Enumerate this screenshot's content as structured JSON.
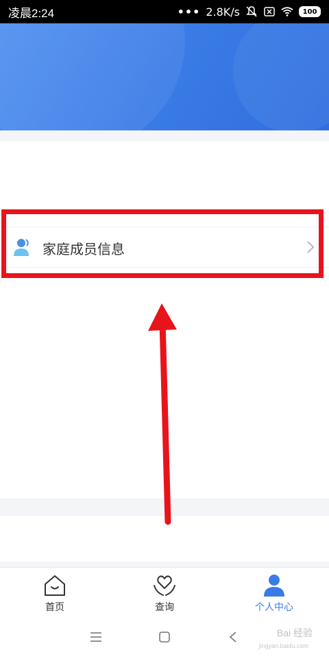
{
  "status_bar": {
    "time": "凌晨2:24",
    "dots": "•••",
    "network_speed": "2.8K/s",
    "battery": "100"
  },
  "menu": {
    "family_members_label": "家庭成员信息"
  },
  "tabs": [
    {
      "label": "首页",
      "icon": "home-icon",
      "active": false
    },
    {
      "label": "查询",
      "icon": "heart-hands-icon",
      "active": false
    },
    {
      "label": "个人中心",
      "icon": "person-icon",
      "active": true
    }
  ],
  "watermark": {
    "text": "Bai 经验",
    "sub": "jingyan.baidu.com"
  },
  "colors": {
    "banner": "#3a7be6",
    "highlight": "#e8141b",
    "active_tab": "#3a7be6"
  }
}
